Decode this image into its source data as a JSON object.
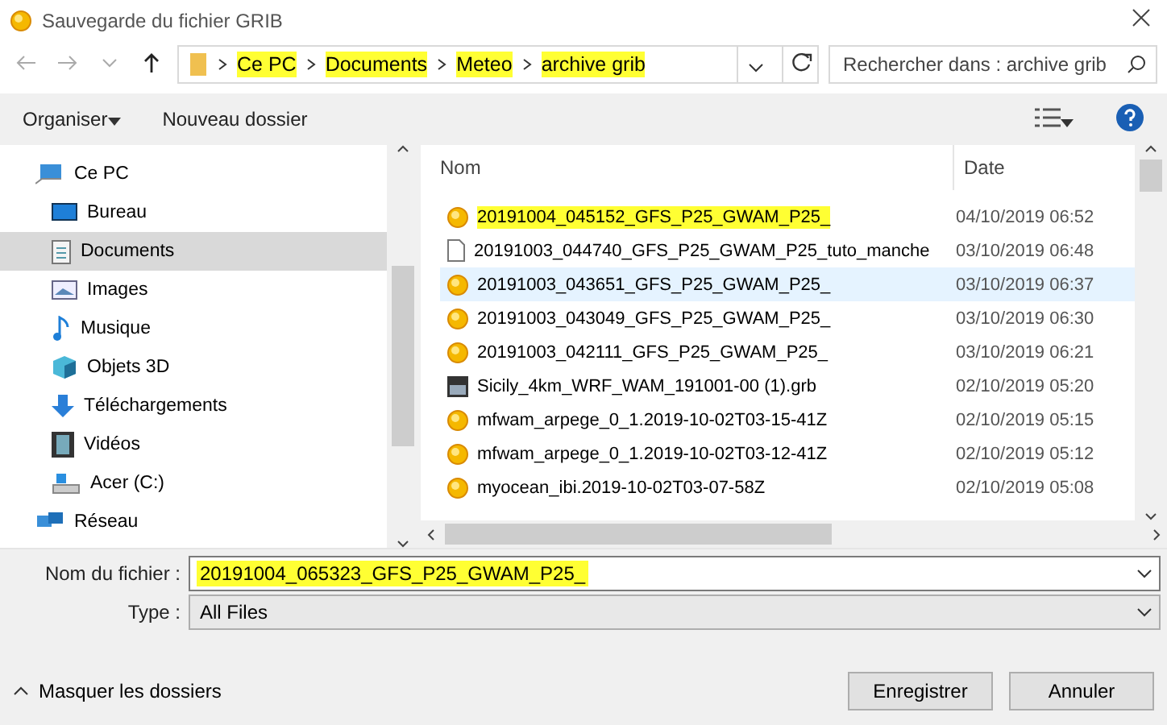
{
  "window": {
    "title": "Sauvegarde du fichier GRIB"
  },
  "address_bar": {
    "segments": [
      {
        "label": "Ce PC",
        "highlighted": true
      },
      {
        "label": "Documents",
        "highlighted": true
      },
      {
        "label": "Meteo",
        "highlighted": true
      },
      {
        "label": "archive grib",
        "highlighted": true
      }
    ]
  },
  "search": {
    "placeholder": "Rechercher dans : archive grib"
  },
  "toolbar": {
    "organize": "Organiser",
    "new_folder": "Nouveau dossier"
  },
  "sidebar": {
    "items": [
      {
        "label": "Ce PC",
        "kind": "pc",
        "selected": false,
        "children": [
          {
            "label": "Bureau",
            "kind": "desktop",
            "selected": false
          },
          {
            "label": "Documents",
            "kind": "documents",
            "selected": true
          },
          {
            "label": "Images",
            "kind": "pictures",
            "selected": false
          },
          {
            "label": "Musique",
            "kind": "music",
            "selected": false
          },
          {
            "label": "Objets 3D",
            "kind": "cube",
            "selected": false
          },
          {
            "label": "Téléchargements",
            "kind": "download",
            "selected": false
          },
          {
            "label": "Vidéos",
            "kind": "video",
            "selected": false
          },
          {
            "label": "Acer (C:)",
            "kind": "drive",
            "selected": false
          }
        ]
      },
      {
        "label": "Réseau",
        "kind": "network",
        "selected": false
      }
    ]
  },
  "table": {
    "columns": [
      "Nom",
      "Date"
    ],
    "rows": [
      {
        "name": "20191004_045152_GFS_P25_GWAM_P25_",
        "date": "04/10/2019 06:52",
        "kind": "grib",
        "selected": false,
        "highlighted": true
      },
      {
        "name": "20191003_044740_GFS_P25_GWAM_P25_tuto_manche",
        "date": "03/10/2019 06:48",
        "kind": "file",
        "selected": false,
        "highlighted": false
      },
      {
        "name": "20191003_043651_GFS_P25_GWAM_P25_",
        "date": "03/10/2019 06:37",
        "kind": "grib",
        "selected": true,
        "highlighted": false
      },
      {
        "name": "20191003_043049_GFS_P25_GWAM_P25_",
        "date": "03/10/2019 06:30",
        "kind": "grib",
        "selected": false,
        "highlighted": false
      },
      {
        "name": "20191003_042111_GFS_P25_GWAM_P25_",
        "date": "03/10/2019 06:21",
        "kind": "grib",
        "selected": false,
        "highlighted": false
      },
      {
        "name": "Sicily_4km_WRF_WAM_191001-00 (1).grb",
        "date": "02/10/2019 05:20",
        "kind": "image",
        "selected": false,
        "highlighted": false
      },
      {
        "name": "mfwam_arpege_0_1.2019-10-02T03-15-41Z",
        "date": "02/10/2019 05:15",
        "kind": "grib",
        "selected": false,
        "highlighted": false
      },
      {
        "name": "mfwam_arpege_0_1.2019-10-02T03-12-41Z",
        "date": "02/10/2019 05:12",
        "kind": "grib",
        "selected": false,
        "highlighted": false
      },
      {
        "name": "myocean_ibi.2019-10-02T03-07-58Z",
        "date": "02/10/2019 05:08",
        "kind": "grib",
        "selected": false,
        "highlighted": false
      }
    ]
  },
  "form": {
    "filename_label": "Nom du fichier :",
    "filename": "20191004_065323_GFS_P25_GWAM_P25_",
    "filename_highlighted": true,
    "type_label": "Type :",
    "type": "All Files"
  },
  "hide_folders": "Masquer les dossiers",
  "buttons": [
    {
      "label": "Enregistrer"
    },
    {
      "label": "Annuler"
    }
  ]
}
